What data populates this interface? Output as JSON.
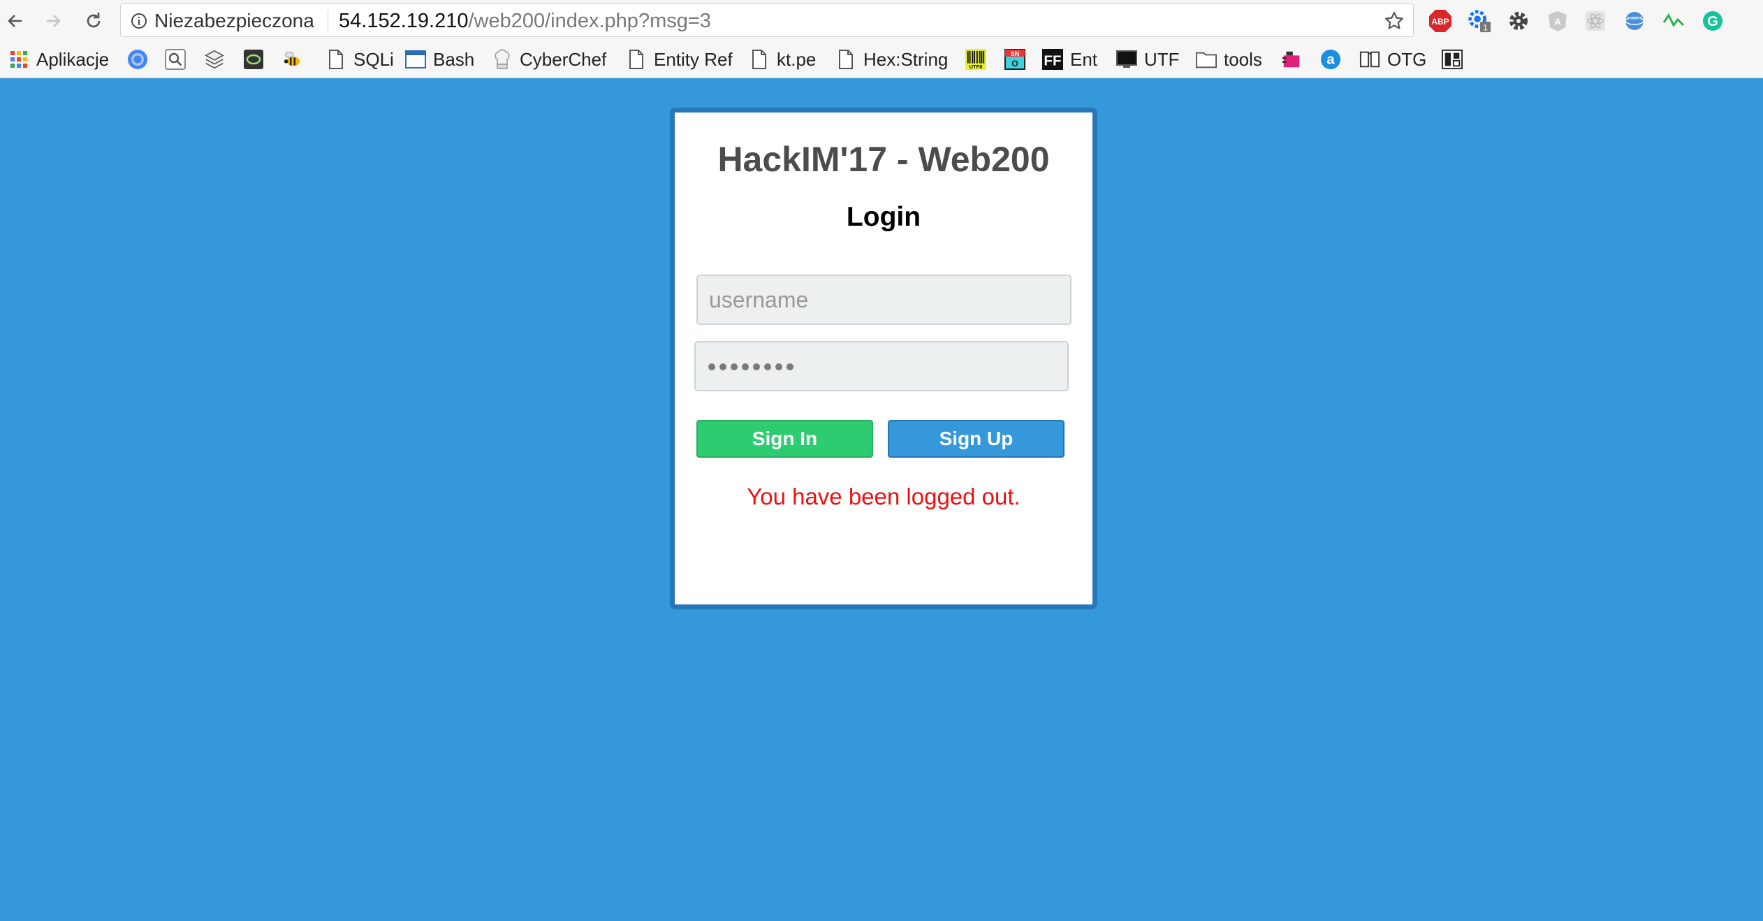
{
  "browser": {
    "security_label": "Niezabezpieczona",
    "url_host": "54.152.19.210",
    "url_path": "/web200/index.php?msg=3",
    "nav": [
      "back-icon",
      "forward-icon",
      "reload-icon"
    ],
    "extensions": [
      {
        "name": "adblock-plus-icon",
        "label": "ABP",
        "color": "#d9262b"
      },
      {
        "name": "extension-gear-badge-icon",
        "badge": "1",
        "color": "#1a73e8"
      },
      {
        "name": "settings-gear-icon",
        "color": "#444444"
      },
      {
        "name": "angular-devtools-icon",
        "color": "#bbbbbb"
      },
      {
        "name": "react-devtools-icon",
        "color": "#cccccc"
      },
      {
        "name": "globe-icon",
        "color": "#4a90d9"
      },
      {
        "name": "wave-extension-icon",
        "color": "#2bb24c"
      },
      {
        "name": "grammarly-icon",
        "color": "#15c39a"
      }
    ]
  },
  "bookmarks": [
    {
      "name": "apps",
      "label": "Aplikacje",
      "icon": "apps-grid-icon"
    },
    {
      "name": "chrome",
      "label": "",
      "icon": "chrome-icon"
    },
    {
      "name": "search",
      "label": "",
      "icon": "search-box-icon"
    },
    {
      "name": "layers",
      "label": "",
      "icon": "layers-icon"
    },
    {
      "name": "shell",
      "label": "",
      "icon": "terminal-swirl-icon"
    },
    {
      "name": "bee",
      "label": "",
      "icon": "bee-icon"
    },
    {
      "name": "sqli",
      "label": "SQLi",
      "icon": "page-icon"
    },
    {
      "name": "bash",
      "label": "Bash",
      "icon": "window-icon"
    },
    {
      "name": "cyberchef",
      "label": "CyberChef",
      "icon": "chef-hat-icon"
    },
    {
      "name": "entity-ref",
      "label": "Entity Ref",
      "icon": "page-icon"
    },
    {
      "name": "kt-pe",
      "label": "kt.pe",
      "icon": "page-icon"
    },
    {
      "name": "hex-string",
      "label": "Hex:String",
      "icon": "page-icon"
    },
    {
      "name": "utf8",
      "label": "",
      "icon": "utf8-barcode-icon"
    },
    {
      "name": "sno",
      "label": "",
      "icon": "sno-icon"
    },
    {
      "name": "ent",
      "label": "Ent",
      "icon": "ff-icon"
    },
    {
      "name": "utf",
      "label": "UTF",
      "icon": "monitor-icon"
    },
    {
      "name": "tools",
      "label": "tools",
      "icon": "folder-icon"
    },
    {
      "name": "pink-tool",
      "label": "",
      "icon": "pink-puzzle-icon"
    },
    {
      "name": "a-tool",
      "label": "",
      "icon": "letter-a-circle-icon"
    },
    {
      "name": "otg",
      "label": "OTG",
      "icon": "book-icon"
    },
    {
      "name": "pb",
      "label": "",
      "icon": "pb-icon"
    }
  ],
  "page": {
    "background": "#3598db",
    "title": "HackIM'17 - Web200",
    "heading": "Login",
    "username_placeholder": "username",
    "password_value": "••••••••",
    "signin_label": "Sign In",
    "signup_label": "Sign Up",
    "status_message": "You have been logged out.",
    "colors": {
      "signin": "#2ecc71",
      "signup": "#3598db",
      "message": "#ee1111",
      "card_border": "#2777b8"
    }
  }
}
